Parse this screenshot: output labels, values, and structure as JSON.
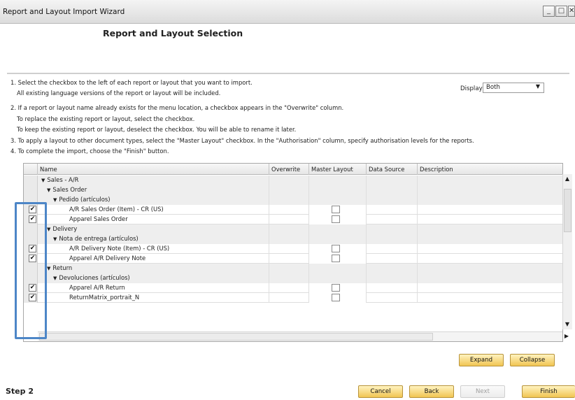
{
  "window": {
    "title": "Report and Layout Import Wizard",
    "minimize_glyph": "_",
    "maximize_glyph": "□",
    "close_glyph": "✕"
  },
  "header": {
    "title": "Report and Layout Selection"
  },
  "instructions": [
    "1. Select the checkbox to the left of each report or layout that you want to import.",
    "All existing language versions of the report or layout will be included.",
    "2. If a report or layout name already exists for the menu location, a checkbox appears in the \"Overwrite\" column.",
    "To replace the existing report or layout, select the checkbox.",
    "To keep the existing report or layout, deselect the checkbox. You will be able to rename it later.",
    "3. To apply a layout to other document types, select the \"Master Layout\" checkbox. In the \"Authorisation\" column, specify authorisation levels for the reports.",
    "4. To complete the import, choose the \"Finish\" button."
  ],
  "display": {
    "label": "Display:",
    "value": "Both",
    "caret": "▼"
  },
  "grid": {
    "columns": [
      "Name",
      "Overwrite",
      "Master Layout",
      "Data Source",
      "Description"
    ],
    "rows": [
      {
        "label": "Sales - A/R",
        "level": 0,
        "group": true,
        "checked": false
      },
      {
        "label": "Sales Order",
        "level": 1,
        "group": true,
        "checked": false
      },
      {
        "label": "Pedido (artículos)",
        "level": 2,
        "group": true,
        "checked": false
      },
      {
        "label": "A/R Sales Order (Item) - CR (US)",
        "level": 3,
        "group": false,
        "checked": true
      },
      {
        "label": "Apparel Sales Order",
        "level": 3,
        "group": false,
        "checked": true
      },
      {
        "label": "Delivery",
        "level": 1,
        "group": true,
        "checked": false
      },
      {
        "label": "Nota de entrega (artículos)",
        "level": 2,
        "group": true,
        "checked": false
      },
      {
        "label": "A/R Delivery Note (Item) - CR (US)",
        "level": 3,
        "group": false,
        "checked": true
      },
      {
        "label": "Apparel A/R Delivery Note",
        "level": 3,
        "group": false,
        "checked": true
      },
      {
        "label": "Return",
        "level": 1,
        "group": true,
        "checked": false
      },
      {
        "label": "Devoluciones (artículos)",
        "level": 2,
        "group": true,
        "checked": false
      },
      {
        "label": "Apparel  A/R Return",
        "level": 3,
        "group": false,
        "checked": true
      },
      {
        "label": "ReturnMatrix_portrait_N",
        "level": 3,
        "group": false,
        "checked": true
      }
    ],
    "arrow_glyph": "▼",
    "check_glyph": "✔",
    "scroll_up_glyph": "▲",
    "scroll_down_glyph": "▼",
    "scroll_right_glyph": "▶",
    "highlight_color": "#4d86c7"
  },
  "buttons": {
    "expand": "Expand",
    "collapse": "Collapse",
    "cancel": "Cancel",
    "back": "Back",
    "next": "Next",
    "finish": "Finish"
  },
  "footer": {
    "step": "Step 2"
  }
}
